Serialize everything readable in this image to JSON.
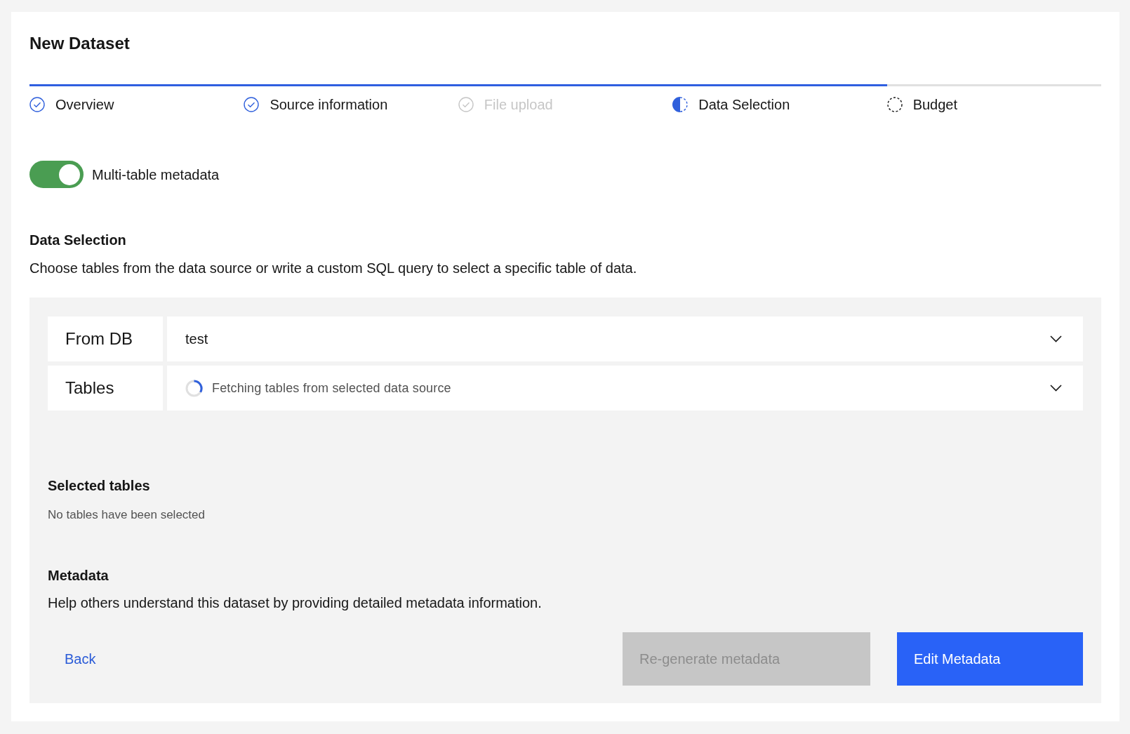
{
  "title": "New Dataset",
  "steps": [
    {
      "label": "Overview",
      "complete": true,
      "current": false,
      "disabled": false
    },
    {
      "label": "Source information",
      "complete": true,
      "current": false,
      "disabled": false
    },
    {
      "label": "File upload",
      "complete": true,
      "current": false,
      "disabled": true
    },
    {
      "label": "Data Selection",
      "complete": false,
      "current": true,
      "disabled": false
    },
    {
      "label": "Budget",
      "complete": false,
      "current": false,
      "disabled": false
    }
  ],
  "toggle": {
    "label": "Multi-table metadata",
    "on": true
  },
  "data_selection": {
    "heading": "Data Selection",
    "description": "Choose tables from the data source or write a custom SQL query to select a specific table of data."
  },
  "fields": [
    {
      "label": "From DB",
      "kind": "select",
      "value": "test"
    },
    {
      "label": "Tables",
      "kind": "loading",
      "value": "Fetching tables from selected data source"
    }
  ],
  "selected_tables": {
    "heading": "Selected tables",
    "empty_text": "No tables have been selected"
  },
  "metadata": {
    "heading": "Metadata",
    "description": "Help others understand this dataset by providing detailed metadata information."
  },
  "actions": {
    "back": "Back",
    "buttons": [
      {
        "label": "Re-generate metadata",
        "disabled": true
      },
      {
        "label": "Edit Metadata",
        "disabled": false
      }
    ]
  }
}
